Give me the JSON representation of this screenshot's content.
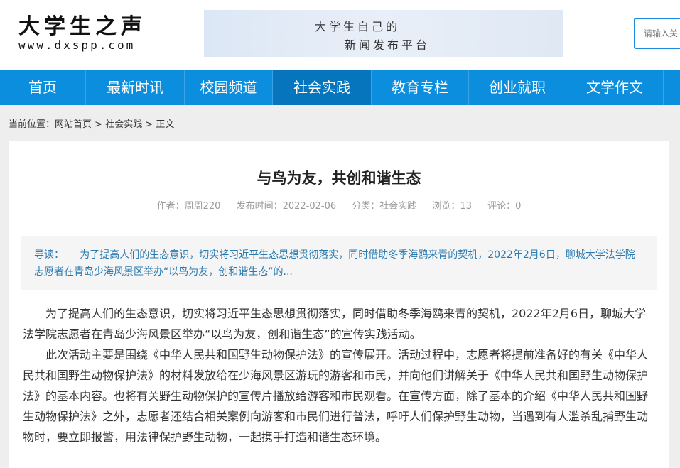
{
  "site": {
    "name": "大学生之声",
    "url": "www.dxspp.com",
    "banner_line1": "大学生自己的",
    "banner_line2": "新闻发布平台",
    "search_placeholder": "请输入关"
  },
  "nav": {
    "items": [
      {
        "label": "首页"
      },
      {
        "label": "最新时讯"
      },
      {
        "label": "校园频道"
      },
      {
        "label": "社会实践",
        "active": true
      },
      {
        "label": "教育专栏"
      },
      {
        "label": "创业就职"
      },
      {
        "label": "文学作文"
      }
    ]
  },
  "breadcrumb": {
    "prefix": "当前位置：",
    "home": "网站首页",
    "sep1": " > ",
    "category": "社会实践",
    "sep2": " > ",
    "current": "正文"
  },
  "article": {
    "title": "与鸟为友，共创和谐生态",
    "meta": {
      "author": "作者：周周220",
      "date": "发布时间：2022-02-06",
      "category": "分类：社会实践",
      "views": "浏览：13",
      "comments": "评论：0"
    },
    "summary_label": "导读：",
    "summary": "为了提高人们的生态意识，切实将习近平生态思想贯彻落实，同时借助冬季海鸥来青的契机，2022年2月6日，聊城大学法学院志愿者在青岛少海风景区举办“以鸟为友，创和谐生态”的...",
    "paragraphs": [
      "为了提高人们的生态意识，切实将习近平生态思想贯彻落实，同时借助冬季海鸥来青的契机，2022年2月6日，聊城大学法学院志愿者在青岛少海风景区举办“以鸟为友，创和谐生态”的宣传实践活动。",
      "此次活动主要是围绕《中华人民共和国野生动物保护法》的宣传展开。活动过程中，志愿者将提前准备好的有关《中华人民共和国野生动物保护法》的材料发放给在少海风景区游玩的游客和市民，并向他们讲解关于《中华人民共和国野生动物保护法》的基本内容。也将有关野生动物保护的宣传片播放给游客和市民观看。在宣传方面，除了基本的介绍《中华人民共和国野生动物保护法》之外，志愿者还结合相关案例向游客和市民们进行普法，呼吁人们保护野生动物，当遇到有人滥杀乱捕野生动物时，要立即报警，用法律保护野生动物，一起携手打造和谐生态环境。"
    ]
  },
  "colors": {
    "nav_bg": "#0b8ede",
    "nav_active": "#0675be",
    "summary_text": "#2a7ab0"
  }
}
